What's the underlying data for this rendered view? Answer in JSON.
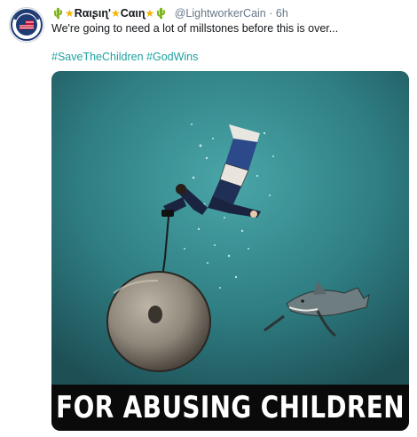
{
  "tweet": {
    "display_name_parts": {
      "first": "Rαιʂιɳ'",
      "second": "Cαιɳ"
    },
    "handle": "@LightworkerCain",
    "separator": "·",
    "time": "6h",
    "text": "We're going to need a lot of millstones before this is over...",
    "hashtags": [
      "#SaveTheChildren",
      "#GodWins"
    ],
    "image_caption": "FOR ABUSING CHILDREN",
    "icons": {
      "avatar": "wwg1wga-badge-icon",
      "emoji_a": "cactus-icon",
      "emoji_b": "star-icon"
    }
  }
}
